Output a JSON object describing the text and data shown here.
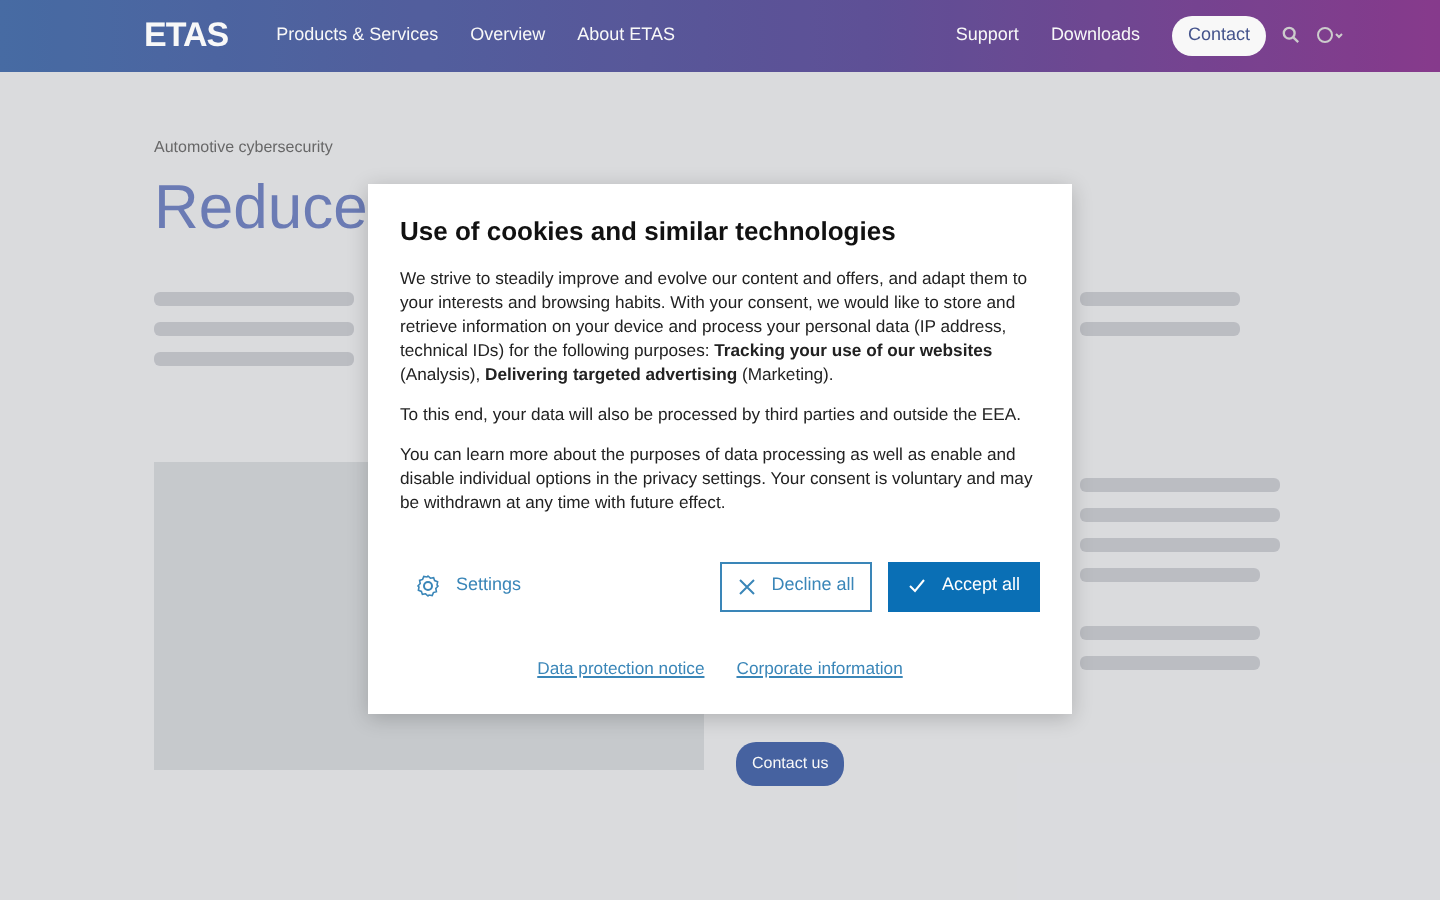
{
  "header": {
    "logo": "ETAS",
    "nav": [
      "Products & Services",
      "Overview",
      "About ETAS"
    ],
    "utility": [
      "Support",
      "Downloads"
    ],
    "contact": "Contact"
  },
  "page": {
    "breadcrumb": "Automotive cybersecurity",
    "title": "Reduce",
    "cta": "Contact us"
  },
  "dialog": {
    "title": "Use of cookies and similar technologies",
    "paragraphs": [
      "We strive to steadily improve and evolve our content and offers, and adapt them to your interests and browsing habits. With your consent, we would like to store and retrieve information on your device and process your personal data (IP address, technical IDs) for the following purposes: **Tracking your use of our websites** (Analysis), **Delivering targeted advertising** (Marketing).",
      "To this end, your data will also be processed by third parties and outside the EEA.",
      "You can learn more about the purposes of data processing as well as enable and disable individual options in the privacy settings. Your consent is voluntary and may be withdrawn at any time with future effect."
    ],
    "settings": "Settings",
    "decline": "Decline all",
    "accept": "Accept all",
    "links": [
      "Data protection notice",
      "Corporate information"
    ]
  }
}
